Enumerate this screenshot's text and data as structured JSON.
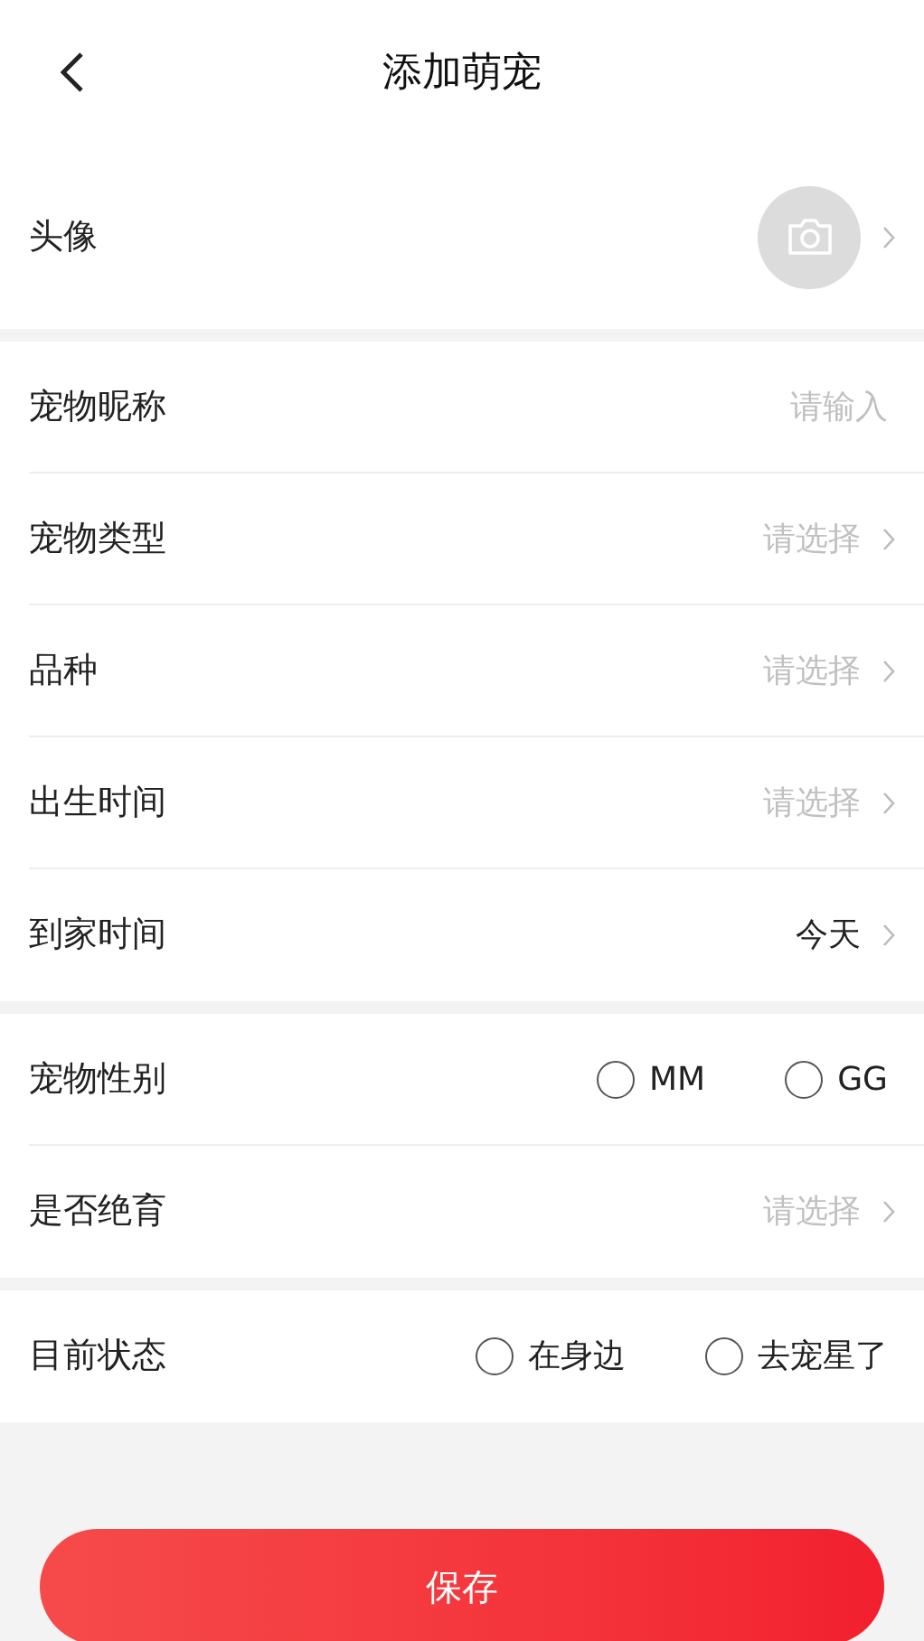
{
  "header": {
    "title": "添加萌宠"
  },
  "sections": [
    {
      "rows": [
        {
          "kind": "avatar",
          "label": "头像"
        }
      ]
    },
    {
      "rows": [
        {
          "kind": "input",
          "label": "宠物昵称",
          "placeholder": "请输入"
        },
        {
          "kind": "select",
          "label": "宠物类型",
          "placeholder": "请选择"
        },
        {
          "kind": "select",
          "label": "品种",
          "placeholder": "请选择"
        },
        {
          "kind": "select",
          "label": "出生时间",
          "placeholder": "请选择"
        },
        {
          "kind": "select",
          "label": "到家时间",
          "value": "今天"
        }
      ]
    },
    {
      "rows": [
        {
          "kind": "radio",
          "label": "宠物性别",
          "options": [
            {
              "label": "MM",
              "selected": false
            },
            {
              "label": "GG",
              "selected": false
            }
          ]
        },
        {
          "kind": "select",
          "label": "是否绝育",
          "placeholder": "请选择"
        }
      ]
    },
    {
      "rows": [
        {
          "kind": "radio",
          "label": "目前状态",
          "options": [
            {
              "label": "在身边",
              "selected": false
            },
            {
              "label": "去宠星了",
              "selected": false
            }
          ]
        }
      ]
    }
  ],
  "save_button": {
    "label": "保存"
  }
}
